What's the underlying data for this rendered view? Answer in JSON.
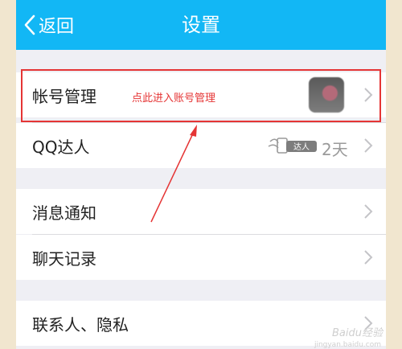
{
  "navbar": {
    "back_label": "返回",
    "title": "设置"
  },
  "rows": {
    "account": "帐号管理",
    "qq_talent": "QQ达人",
    "qq_talent_badge": "达人",
    "qq_talent_days": "2天",
    "notifications": "消息通知",
    "chat_history": "聊天记录",
    "contacts_privacy": "联系人、隐私"
  },
  "annotation": {
    "text": "点此进入账号管理"
  },
  "watermark": {
    "text": "Baidu经验",
    "sub": "jingyan.baidu.com"
  },
  "colors": {
    "navbar": "#12b7f5",
    "highlight": "#e53535",
    "page_bg": "#efeff4"
  },
  "icons": [
    "chevron-left-icon",
    "chevron-right-icon",
    "talent-badge-icon"
  ]
}
